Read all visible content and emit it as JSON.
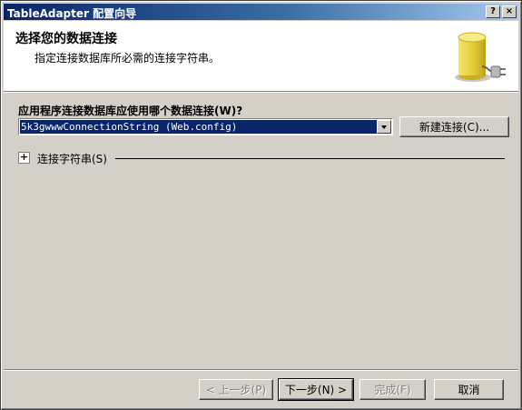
{
  "window": {
    "title": "TableAdapter 配置向导",
    "help_label": "?",
    "close_label": "×"
  },
  "header": {
    "title": "选择您的数据连接",
    "description": "指定连接数据库所必需的连接字符串。",
    "icon": "database-plug-icon"
  },
  "connection": {
    "question": "应用程序连接数据库应使用哪个数据连接(W)?",
    "selected_value": "5k3gwwwConnectionString (Web.config)",
    "new_connection_label": "新建连接(C)..."
  },
  "connection_string": {
    "toggle_symbol": "+",
    "label": "连接字符串(S)"
  },
  "footer": {
    "prev_label": "< 上一步(P)",
    "next_label": "下一步(N) >",
    "finish_label": "完成(F)",
    "cancel_label": "取消"
  },
  "colors": {
    "title_bar_start": "#0a246a",
    "title_bar_end": "#a6caf0",
    "dialog_face": "#d4d0c8",
    "selection": "#0a246a"
  }
}
